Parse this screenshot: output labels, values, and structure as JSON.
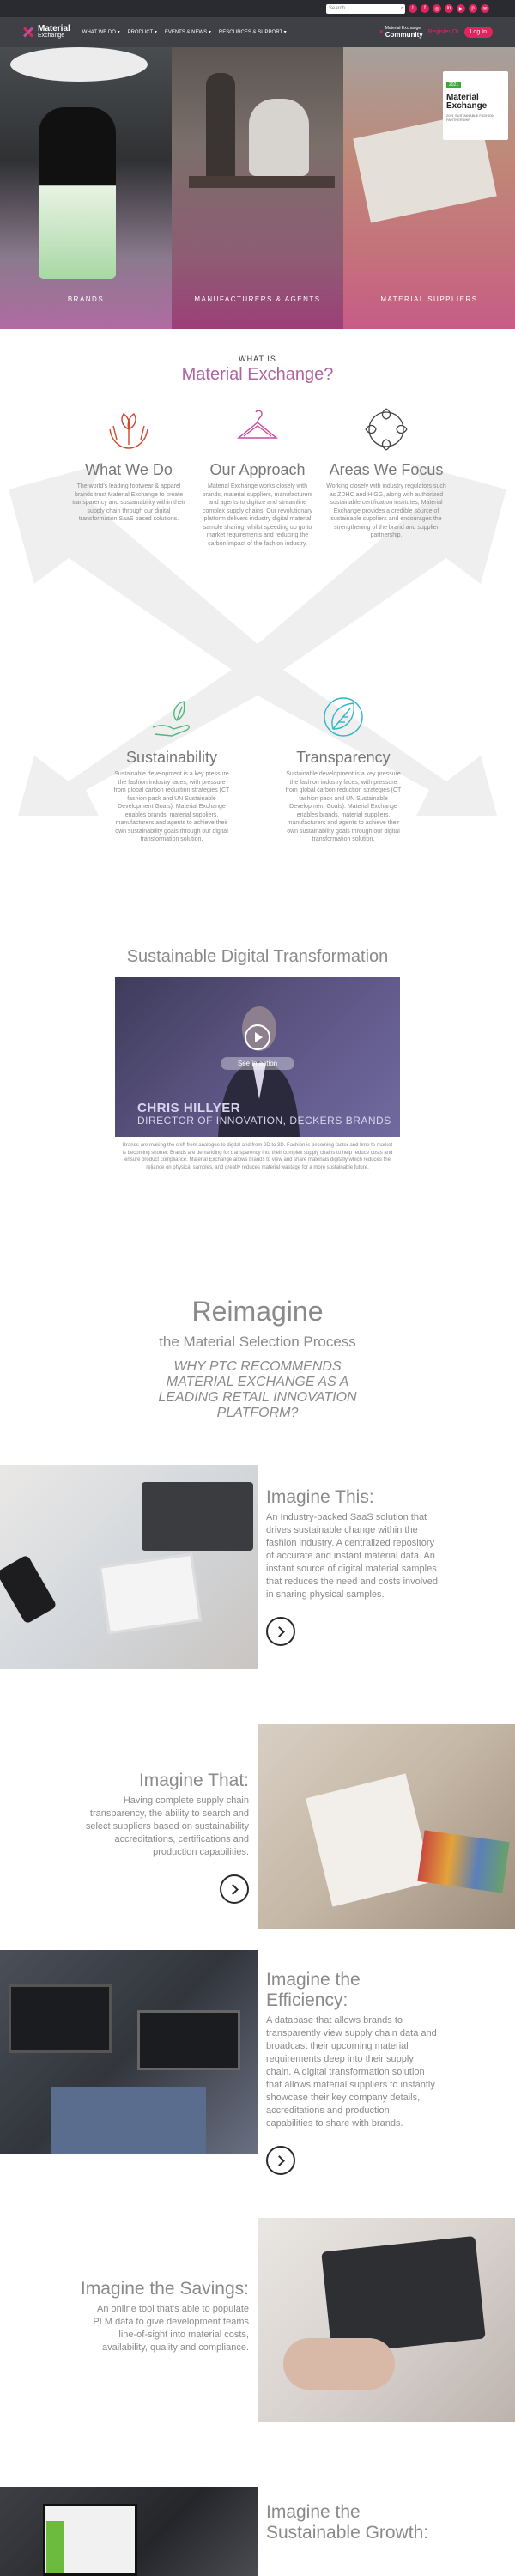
{
  "topbar": {
    "search_placeholder": "Search",
    "search_icon": "search-icon",
    "social": [
      "twitter",
      "facebook",
      "instagram",
      "linkedin",
      "youtube",
      "pinterest",
      "email"
    ]
  },
  "nav": {
    "logo": "Material",
    "logo_sub": "Exchange",
    "menu": [
      "WHAT WE DO ▾",
      "PRODUCT ▾",
      "EVENTS & NEWS ▾",
      "RESOURCES & SUPPORT ▾"
    ],
    "community": "Community",
    "community_prefix": "Material Exchange",
    "signin": "Register Or",
    "login": "Log In"
  },
  "hero": {
    "panels": [
      "BRANDS",
      "MANUFACTURERS & AGENTS",
      "MATERIAL SUPPLIERS"
    ],
    "badge_tag": "2021",
    "badge_title": "Material Exchange",
    "badge_sub": "2021 SUSTAINABLE FASHION PARTNERSHIP"
  },
  "what_is": {
    "kicker": "WHAT IS",
    "title": "Material Exchange?",
    "features": [
      {
        "title": "What We Do",
        "body": "The world's leading footwear & apparel brands trust Material Exchange to create transparency and sustainability within their supply chain through our digital transformation SaaS based solutions."
      },
      {
        "title": "Our Approach",
        "body": "Material Exchange works closely with brands, material suppliers, manufacturers and agents to digitize and streamline complex supply chains. Our revolutionary platform delivers industry digital material sample sharing, whilst speeding up go to market requirements and reducing the carbon impact of the fashion industry."
      },
      {
        "title": "Areas We Focus",
        "body": "Working closely with industry regulators such as ZDHC and HIGG, along with authorized sustainable certification institutes, Material Exchange provides a credible source of sustainable suppliers and encourages the strengthening of the brand and supplier partnership."
      },
      {
        "title": "Sustainability",
        "body": "Sustainable development is a key pressure the fashion industry faces, with pressure from global carbon reduction strategies (CT fashion pack and UN Sustainable Development Goals). Material Exchange enables brands, material suppliers, manufacturers and agents to achieve their own sustainability goals through our digital transformation solution."
      },
      {
        "title": "Transparency",
        "body": "Sustainable development is a key pressure the fashion industry faces, with pressure from global carbon reduction strategies (CT fashion pack and UN Sustainable Development Goals). Material Exchange enables brands, material suppliers, manufacturers and agents to achieve their own sustainability goals through our digital transformation solution."
      }
    ]
  },
  "sdt": {
    "title": "Sustainable Digital Transformation",
    "video_cta": "See in action",
    "video_name": "CHRIS HILLYER",
    "video_role": "DIRECTOR OF INNOVATION, DECKERS BRANDS",
    "caption": "Brands are making the shift from analogue to digital and from 2D to 3D. Fashion is becoming faster and time to market is becoming shorter. Brands are demanding for transparency into their complex supply chains to help reduce costs and ensure product compliance. Material Exchange allows brands to view and share materials digitally which reduces the reliance on physical samples, and greatly reduces material wastage for a more sustainable future."
  },
  "reimagine": {
    "title": "Reimagine",
    "subtitle": "the Material Selection Process",
    "why": "WHY PTC RECOMMENDS MATERIAL EXCHANGE AS A LEADING RETAIL INNOVATION PLATFORM?"
  },
  "imagine": [
    {
      "title": "Imagine This:",
      "body": "An Industry-backed SaaS solution that drives sustainable change within the fashion industry. A centralized repository of accurate and instant material data. An instant source of digital material samples that reduces the need and costs involved in sharing physical samples."
    },
    {
      "title": "Imagine That:",
      "body": "Having complete supply chain transparency, the ability to search and select suppliers based on sustainability accreditations, certifications and production capabilities."
    },
    {
      "title": "Imagine the Efficiency:",
      "body": "A database that allows brands to transparently view supply chain data and broadcast their upcoming material requirements deep into their supply chain. A digital transformation solution that allows material suppliers to instantly showcase their key company details, accreditations and production capabilities to share with brands."
    },
    {
      "title": "Imagine the Savings:",
      "body": "An online tool that's able to populate PLM data to give development teams line-of-sight into material costs, availability, quality and compliance."
    },
    {
      "title": "Imagine the Sustainable Growth:",
      "body": ""
    }
  ],
  "colors": {
    "accent": "#e0245e",
    "title_purple": "#b064a0",
    "nav_bg": "#3f4046",
    "green": "#3aaa35"
  }
}
